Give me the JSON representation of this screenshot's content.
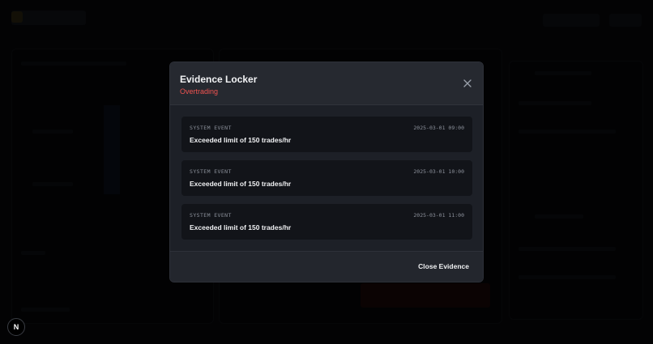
{
  "modal": {
    "title": "Evidence Locker",
    "subtitle": "Overtrading",
    "close_icon": "close-icon",
    "footer_button": "Close Evidence",
    "accent_color": "#ef5350",
    "items": [
      {
        "type": "SYSTEM EVENT",
        "timestamp": "2025-03-01 09:00",
        "message": "Exceeded limit of 150 trades/hr"
      },
      {
        "type": "SYSTEM EVENT",
        "timestamp": "2025-03-01 10:00",
        "message": "Exceeded limit of 150 trades/hr"
      },
      {
        "type": "SYSTEM EVENT",
        "timestamp": "2025-03-01 11:00",
        "message": "Exceeded limit of 150 trades/hr"
      }
    ]
  },
  "badge": {
    "label": "N",
    "icon": "nextjs-logo-icon"
  }
}
